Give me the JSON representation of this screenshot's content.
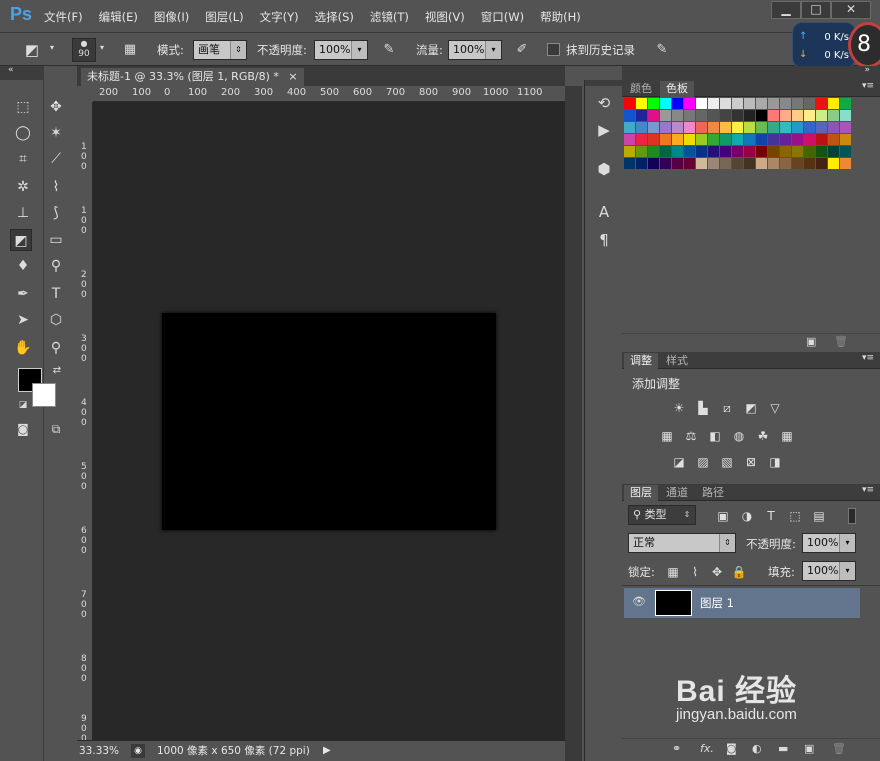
{
  "app": {
    "logo": "Ps"
  },
  "menu": [
    "文件(F)",
    "编辑(E)",
    "图像(I)",
    "图层(L)",
    "文字(Y)",
    "选择(S)",
    "滤镜(T)",
    "视图(V)",
    "窗口(W)",
    "帮助(H)"
  ],
  "window_buttons": {
    "min": "▁",
    "max": "□",
    "close": "✕"
  },
  "options": {
    "brush_size": "90",
    "mode_label": "模式:",
    "mode_value": "画笔",
    "opacity_label": "不透明度:",
    "opacity_value": "100%",
    "flow_label": "流量:",
    "flow_value": "100%",
    "history_label": "抹到历史记录"
  },
  "network": {
    "up": "0 K/s",
    "down": "0 K/s",
    "badge": "8"
  },
  "document": {
    "tab_title": "未标题-1 @ 33.3% (图层 1, RGB/8) *",
    "close": "×",
    "ruler_h": [
      "200",
      "100",
      "0",
      "100",
      "200",
      "300",
      "400",
      "500",
      "600",
      "700",
      "800",
      "900",
      "1000",
      "1100"
    ],
    "ruler_v": [
      "1",
      "0",
      "0",
      "1",
      "0",
      "0",
      "2",
      "0",
      "0",
      "3",
      "0",
      "0",
      "4",
      "0",
      "0",
      "5",
      "0",
      "0",
      "6",
      "0",
      "0",
      "7",
      "0",
      "0",
      "8",
      "0",
      "0",
      "9",
      "0",
      "0"
    ],
    "zoom": "33.33%",
    "doc_info": "1000 像素 x 650 像素 (72 ppi)"
  },
  "swatches_panel": {
    "tabs": [
      "颜色",
      "色板"
    ],
    "active": "色板"
  },
  "swatch_colors": [
    "#ff0000",
    "#ffff00",
    "#00ff00",
    "#00ffff",
    "#0000ff",
    "#ff00ff",
    "#ffffff",
    "#eeeeee",
    "#dddddd",
    "#cccccc",
    "#bbbbbb",
    "#aaaaaa",
    "#999999",
    "#888888",
    "#777777",
    "#666666",
    "#ee1111",
    "#ffee00",
    "#11aa44",
    "#1155cc",
    "#222299",
    "#dd1188",
    "#999999",
    "#888888",
    "#777777",
    "#666666",
    "#555555",
    "#444444",
    "#333333",
    "#222222",
    "#000000",
    "#ff7777",
    "#ffaa88",
    "#ffcc88",
    "#ffee88",
    "#ccee88",
    "#88cc88",
    "#88ddcc",
    "#44aacc",
    "#4488cc",
    "#7799cc",
    "#9977cc",
    "#bb88cc",
    "#ee88cc",
    "#ee6655",
    "#ee8844",
    "#ffbb44",
    "#ffee44",
    "#bbdd44",
    "#66bb55",
    "#33aa88",
    "#33bbbb",
    "#2299cc",
    "#3366cc",
    "#5566bb",
    "#8855bb",
    "#aa55bb",
    "#cc44aa",
    "#ee2244",
    "#dd3322",
    "#ee7722",
    "#ffaa22",
    "#eedd00",
    "#99cc22",
    "#33aa33",
    "#119966",
    "#11aaaa",
    "#1177bb",
    "#1144aa",
    "#443399",
    "#662299",
    "#991188",
    "#cc1166",
    "#bb1111",
    "#bb5511",
    "#cc8811",
    "#bbaa00",
    "#669911",
    "#228822",
    "#006644",
    "#008888",
    "#005599",
    "#003388",
    "#221177",
    "#440077",
    "#770066",
    "#990044",
    "#770000",
    "#774400",
    "#886600",
    "#887700",
    "#446600",
    "#115511",
    "#004433",
    "#005555",
    "#003366",
    "#002266",
    "#110055",
    "#330055",
    "#550044",
    "#660033",
    "#ccbb99",
    "#998877",
    "#776655",
    "#554433",
    "#443322",
    "#ccaa88",
    "#aa8866",
    "#886644",
    "#664422",
    "#553311",
    "#442211",
    "#ffee00",
    "#ee8833"
  ],
  "adjustments_panel": {
    "tabs": [
      "调整",
      "样式"
    ],
    "title": "添加调整"
  },
  "layers_panel": {
    "tabs": [
      "图层",
      "通道",
      "路径"
    ],
    "filter": "类型",
    "blend": "正常",
    "opacity_label": "不透明度:",
    "opacity_value": "100%",
    "lock_label": "锁定:",
    "fill_label": "填充:",
    "fill_value": "100%",
    "layer_name": "图层 1"
  },
  "watermark": {
    "text": "Bai 经验",
    "url": "jingyan.baidu.com"
  }
}
